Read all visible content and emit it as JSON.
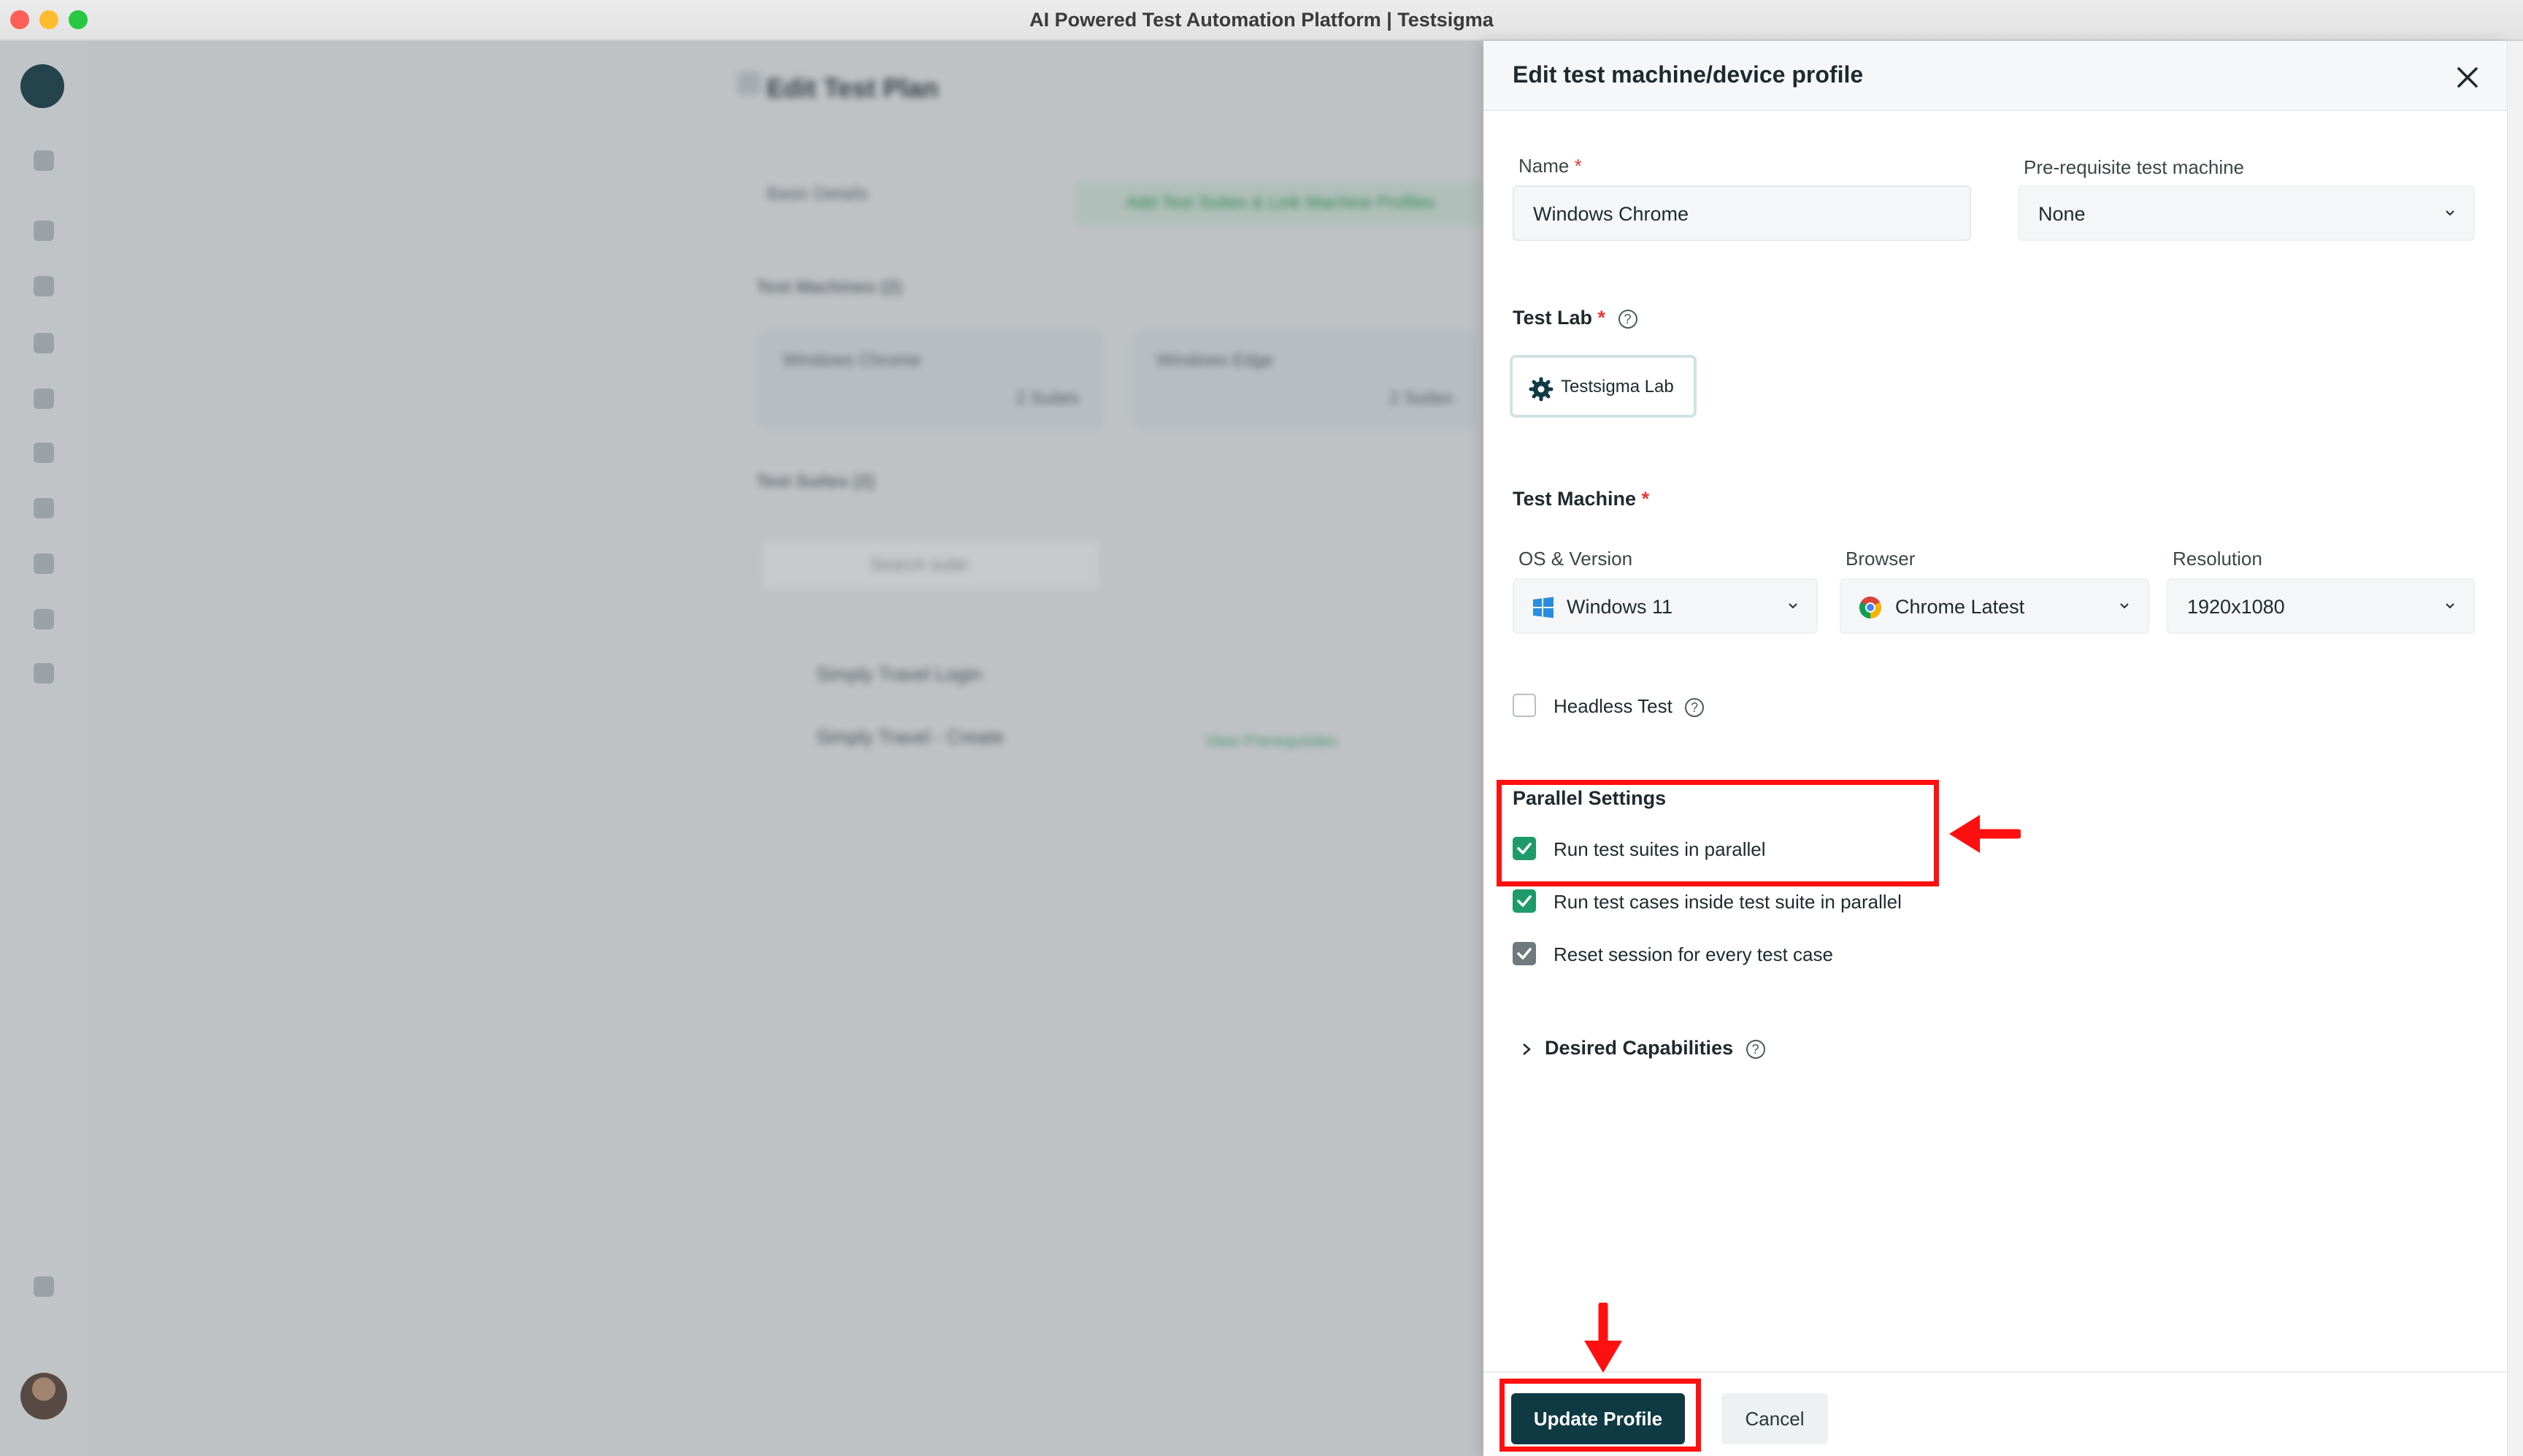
{
  "window": {
    "title": "AI Powered Test Automation Platform | Testsigma"
  },
  "background": {
    "page_title": "Edit Test Plan",
    "back_label": "Basic Details",
    "add_button": "Add Test Suites & Link Machine Profiles",
    "machines_heading": "Test Machines (2)",
    "machines": [
      {
        "name": "Windows Chrome",
        "suites": "2 Suites"
      },
      {
        "name": "Windows Edge",
        "suites": "2 Suites"
      }
    ],
    "suites_heading": "Test Suites (2)",
    "search_placeholder": "Search suite",
    "suites": [
      "Simply Travel Login",
      "Simply Travel - Create"
    ],
    "view_prereq": "View Prerequisites"
  },
  "panel": {
    "title": "Edit test machine/device profile",
    "name_label": "Name",
    "name_value": "Windows Chrome",
    "prereq_label": "Pre-requisite test machine",
    "prereq_value": "None",
    "lab_label": "Test Lab",
    "lab_button": "Testsigma Lab",
    "machine_label": "Test Machine",
    "os_label": "OS & Version",
    "os_value": "Windows 11",
    "browser_label": "Browser",
    "browser_value": "Chrome Latest",
    "resolution_label": "Resolution",
    "resolution_value": "1920x1080",
    "headless_label": "Headless Test",
    "headless_checked": false,
    "parallel_heading": "Parallel Settings",
    "parallel_suites_label": "Run test suites in parallel",
    "parallel_suites_checked": true,
    "parallel_cases_label": "Run test cases inside test suite in parallel",
    "parallel_cases_checked": true,
    "reset_label": "Reset session for every test case",
    "reset_checked": true,
    "capabilities_label": "Desired Capabilities",
    "update_button": "Update Profile",
    "cancel_button": "Cancel"
  },
  "colors": {
    "primary": "#0f3a44",
    "checkbox_on": "#1f9b6a",
    "checkbox_disabled": "#6f7a7e",
    "annotation_red": "#ff1010",
    "required_star": "#e53935"
  }
}
